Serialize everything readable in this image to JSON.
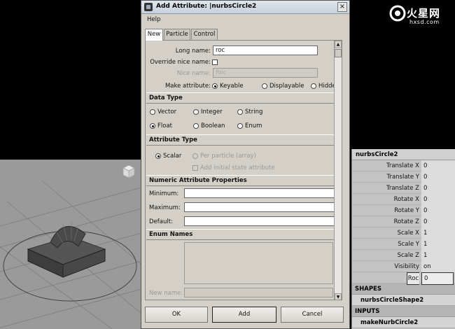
{
  "dialog": {
    "title": "Add Attribute: |nurbsCircle2",
    "close_glyph": "×",
    "menu": [
      "Help"
    ],
    "tabs": [
      "New",
      "Particle",
      "Control"
    ],
    "long_name_label": "Long name:",
    "long_name_value": "roc",
    "override_nice_name_label": "Override nice name:",
    "nice_name_label": "Nice name:",
    "nice_name_value": "Roc",
    "make_attribute_label": "Make attribute:",
    "make_attribute_options": [
      "Keyable",
      "Displayable",
      "Hidden"
    ],
    "data_type_header": "Data Type",
    "data_types": [
      "Vector",
      "Integer",
      "String",
      "Float",
      "Boolean",
      "Enum"
    ],
    "attribute_type_header": "Attribute Type",
    "attribute_types": [
      "Scalar",
      "Per particle (array)"
    ],
    "add_initial_state_label": "Add initial state attribute",
    "numeric_header": "Numeric Attribute Properties",
    "minimum_label": "Minimum:",
    "maximum_label": "Maximum:",
    "default_label": "Default:",
    "enum_header": "Enum Names",
    "new_name_label": "New name:",
    "buttons": {
      "ok": "OK",
      "add": "Add",
      "cancel": "Cancel"
    }
  },
  "channel_box": {
    "title": "nurbsCircle2",
    "attributes": [
      {
        "label": "Translate X",
        "value": "0"
      },
      {
        "label": "Translate Y",
        "value": "0"
      },
      {
        "label": "Translate Z",
        "value": "0"
      },
      {
        "label": "Rotate X",
        "value": "0"
      },
      {
        "label": "Rotate Y",
        "value": "0"
      },
      {
        "label": "Rotate Z",
        "value": "0"
      },
      {
        "label": "Scale X",
        "value": "1"
      },
      {
        "label": "Scale Y",
        "value": "1"
      },
      {
        "label": "Scale Z",
        "value": "1"
      },
      {
        "label": "Visibility",
        "value": "on"
      },
      {
        "label": "Roc",
        "value": "0"
      }
    ],
    "shapes_header": "SHAPES",
    "shape_node": "nurbsCircleShape2",
    "inputs_header": "INPUTS",
    "input_node": "makeNurbCircle2"
  },
  "logo": {
    "main": "火星网",
    "sub": "hxsd.com"
  },
  "colors": {
    "dialog_bg": "#d4d0c8",
    "viewport_bg": "#9a9a9a",
    "channel_bg": "#c4c4c4"
  }
}
